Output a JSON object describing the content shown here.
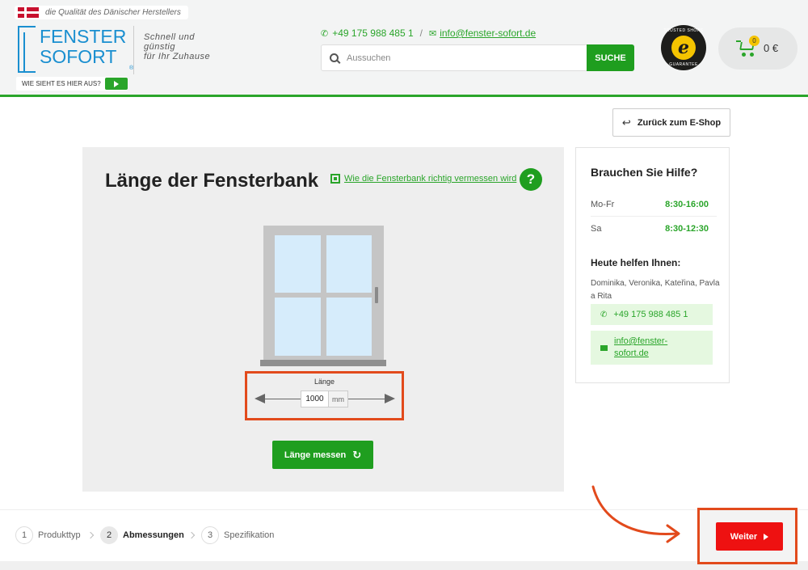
{
  "header": {
    "tagline": "die Qualität des Dänischer Herstellers",
    "logo_line1": "FENSTER",
    "logo_line2": "SOFORT",
    "logo_reg": "®",
    "slogan_line1": "Schnell und",
    "slogan_line2": "günstig",
    "slogan_line3": "für Ihr Zuhause",
    "help_label": "WIE SIEHT ES HIER AUS?",
    "phone": "+49 175 988 485 1",
    "separator": "/",
    "email": "info@fenster-sofort.de",
    "search_placeholder": "Aussuchen",
    "search_button": "SUCHE",
    "trusted_top": "TRUSTED SHOPS",
    "trusted_bottom": "GUARANTEE",
    "trusted_letter": "e",
    "cart_count": "0",
    "cart_total": "0 €"
  },
  "back_button": "Zurück zum E-Shop",
  "main": {
    "title": "Länge der Fensterbank",
    "measure_link": "Wie die Fensterbank richtig vermessen wird",
    "help_icon": "?",
    "length_label": "Länge",
    "length_value": "1000",
    "length_unit": "mm",
    "measure_button": "Länge messen"
  },
  "help_card": {
    "title": "Brauchen Sie Hilfe?",
    "hours": [
      {
        "day": "Mo-Fr",
        "time": "8:30-16:00"
      },
      {
        "day": "Sa",
        "time": "8:30-12:30"
      }
    ],
    "today_title": "Heute helfen Ihnen:",
    "today_names": "Dominika, Veronika, Kateřina, Pavla a Rita",
    "phone": "+49 175 988 485 1",
    "email": "info@fenster-sofort.de"
  },
  "steps": [
    {
      "num": "1",
      "label": "Produkttyp"
    },
    {
      "num": "2",
      "label": "Abmessungen"
    },
    {
      "num": "3",
      "label": "Spezifikation"
    }
  ],
  "next_button": "Weiter",
  "colors": {
    "brand_green": "#2aa52a",
    "brand_blue": "#1a8fd0",
    "highlight_orange": "#e24a1c",
    "next_red": "#ee1111"
  }
}
